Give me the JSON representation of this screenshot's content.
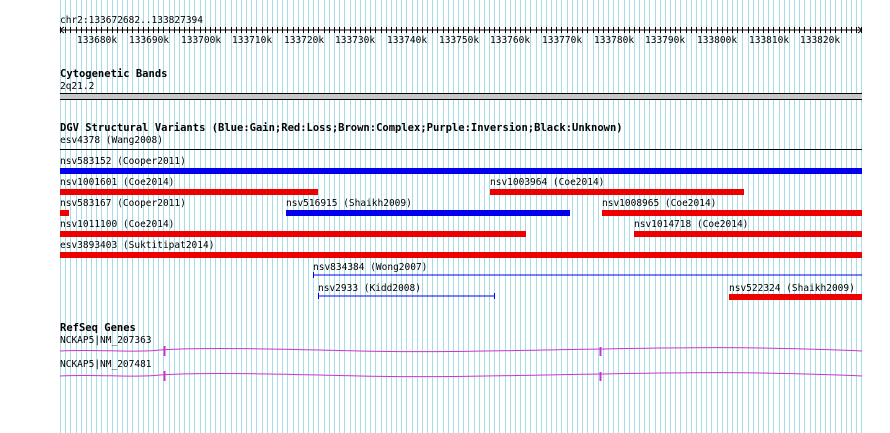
{
  "ruler": {
    "coords": "chr2:133672682..133827394",
    "ticks": [
      "133680k",
      "133690k",
      "133700k",
      "133710k",
      "133720k",
      "133730k",
      "133740k",
      "133750k",
      "133760k",
      "133770k",
      "133780k",
      "133790k",
      "133800k",
      "133810k",
      "133820k"
    ]
  },
  "cytobands": {
    "title": "Cytogenetic Bands",
    "band": "2q21.2"
  },
  "dgv": {
    "title": "DGV Structural Variants (Blue:Gain;Red:Loss;Brown:Complex;Purple:Inversion;Black:Unknown)",
    "features": [
      {
        "id": "esv4378",
        "label": "esv4378 (Wang2008)",
        "type": "unknown"
      },
      {
        "id": "nsv583152",
        "label": "nsv583152 (Cooper2011)",
        "type": "gain"
      },
      {
        "id": "nsv1001601",
        "label": "nsv1001601 (Coe2014)",
        "type": "loss"
      },
      {
        "id": "nsv1003964",
        "label": "nsv1003964 (Coe2014)",
        "type": "loss"
      },
      {
        "id": "nsv583167",
        "label": "nsv583167 (Cooper2011)",
        "type": "loss"
      },
      {
        "id": "nsv516915",
        "label": "nsv516915 (Shaikh2009)",
        "type": "gain"
      },
      {
        "id": "nsv1008965",
        "label": "nsv1008965 (Coe2014)",
        "type": "loss"
      },
      {
        "id": "nsv1011100",
        "label": "nsv1011100 (Coe2014)",
        "type": "loss"
      },
      {
        "id": "nsv1014718",
        "label": "nsv1014718 (Coe2014)",
        "type": "loss"
      },
      {
        "id": "esv3893403",
        "label": "esv3893403 (Suktitipat2014)",
        "type": "loss"
      },
      {
        "id": "nsv834384",
        "label": "nsv834384 (Wong2007)",
        "type": "gain"
      },
      {
        "id": "nsv2933",
        "label": "nsv2933 (Kidd2008)",
        "type": "gain"
      },
      {
        "id": "nsv522324",
        "label": "nsv522324 (Shaikh2009)",
        "type": "loss"
      }
    ]
  },
  "refseq": {
    "title": "RefSeq Genes",
    "genes": [
      {
        "label": "NCKAP5|NM_207363"
      },
      {
        "label": "NCKAP5|NM_207481"
      }
    ]
  },
  "colors": {
    "gain": "#0000ee",
    "loss": "#ee0000",
    "unknown": "#000000",
    "gene": "#cc33cc",
    "grid": "#a8dce8"
  }
}
